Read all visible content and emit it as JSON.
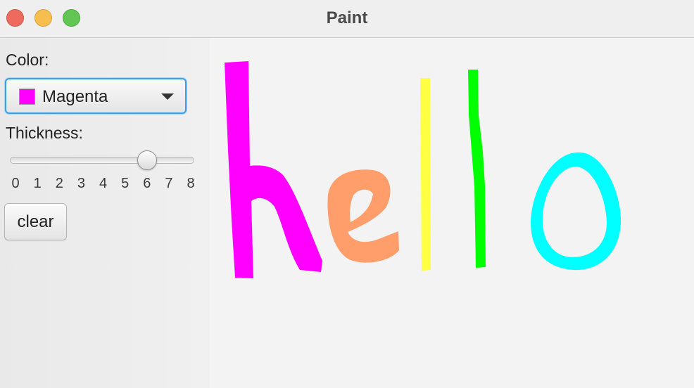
{
  "window": {
    "title": "Paint"
  },
  "sidebar": {
    "color_label": "Color:",
    "color_select": {
      "value": "Magenta",
      "swatch_color": "#ff00ff"
    },
    "thickness_label": "Thickness:",
    "thickness": {
      "value": 6,
      "min": 0,
      "max": 8,
      "ticks": [
        "0",
        "1",
        "2",
        "3",
        "4",
        "5",
        "6",
        "7",
        "8"
      ]
    },
    "clear_label": "clear"
  },
  "canvas": {
    "strokes": [
      {
        "name": "stroke-h-magenta",
        "color": "#ff00ff"
      },
      {
        "name": "stroke-e-orange",
        "color": "#ff9e6a"
      },
      {
        "name": "stroke-l-yellow",
        "color": "#ffff44"
      },
      {
        "name": "stroke-l-green",
        "color": "#00ff00"
      },
      {
        "name": "stroke-o-cyan",
        "color": "#00ffff"
      }
    ]
  }
}
